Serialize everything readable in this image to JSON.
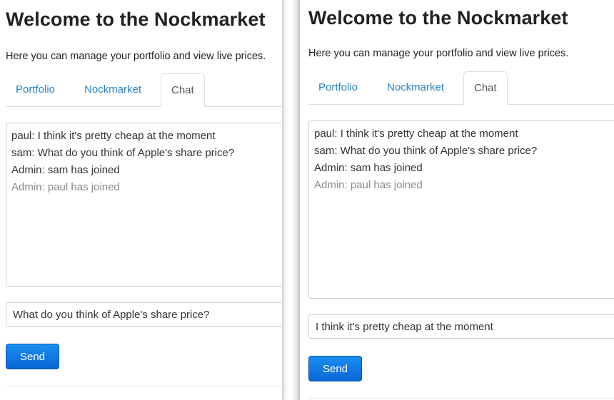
{
  "left": {
    "title": "Welcome to the Nockmarket",
    "subtitle": "Here you can manage your portfolio and view live prices.",
    "tabs": [
      {
        "label": "Portfolio",
        "active": false
      },
      {
        "label": "Nockmarket",
        "active": false
      },
      {
        "label": "Chat",
        "active": true
      }
    ],
    "messages": [
      {
        "text": "paul: I think it's pretty cheap at the moment",
        "faded": false
      },
      {
        "text": "sam: What do you think of Apple's share price?",
        "faded": false
      },
      {
        "text": "Admin: sam has joined",
        "faded": false
      },
      {
        "text": "Admin: paul has joined",
        "faded": true
      }
    ],
    "input_value": "What do you think of Apple's share price?",
    "send_label": "Send"
  },
  "right": {
    "title": "Welcome to the Nockmarket",
    "subtitle": "Here you can manage your portfolio and view live prices.",
    "tabs": [
      {
        "label": "Portfolio",
        "active": false
      },
      {
        "label": "Nockmarket",
        "active": false
      },
      {
        "label": "Chat",
        "active": true
      }
    ],
    "messages": [
      {
        "text": "paul: I think it's pretty cheap at the moment",
        "faded": false
      },
      {
        "text": "sam: What do you think of Apple's share price?",
        "faded": false
      },
      {
        "text": "Admin: sam has joined",
        "faded": false
      },
      {
        "text": "Admin: paul has joined",
        "faded": true
      }
    ],
    "input_value": "I think it's pretty cheap at the moment",
    "send_label": "Send"
  },
  "colors": {
    "link": "#2a86c6",
    "send_button": "#0a66d6",
    "faded_text": "#8a8a8a"
  }
}
